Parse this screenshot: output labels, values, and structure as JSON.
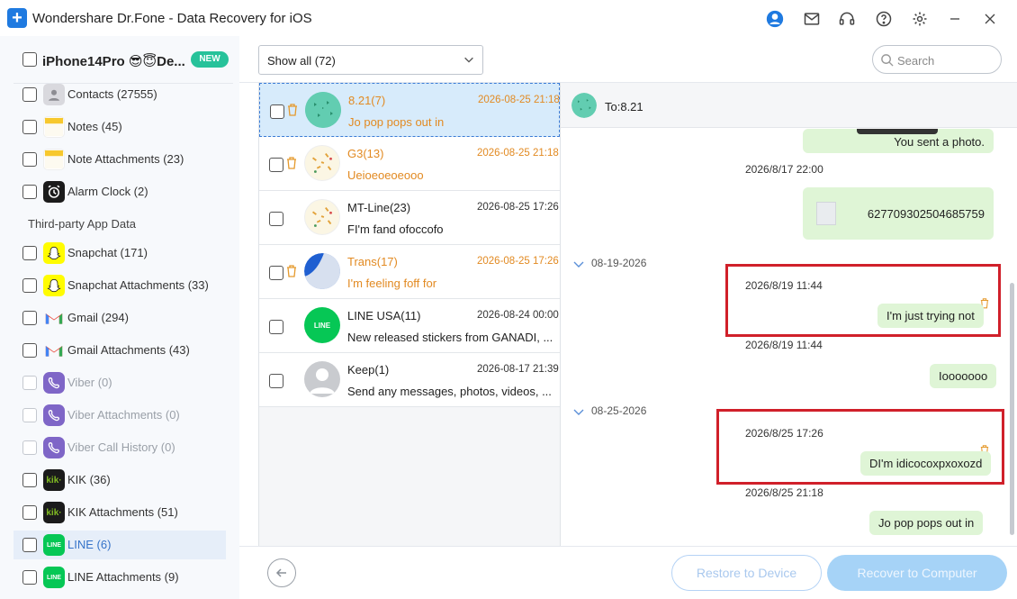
{
  "window": {
    "title": "Wondershare Dr.Fone - Data Recovery for iOS",
    "logo_glyph": "+"
  },
  "sidebar": {
    "device": {
      "name": "iPhone14Pro 😎😇De...",
      "badge": "NEW"
    },
    "section_third_party": "Third-party App Data",
    "items": [
      {
        "label": "Contacts (27555)",
        "icon": "contacts-icon",
        "disabled": false,
        "selected": false
      },
      {
        "label": "Notes (45)",
        "icon": "notes-icon",
        "disabled": false,
        "selected": false
      },
      {
        "label": "Note Attachments (23)",
        "icon": "notes-icon",
        "disabled": false,
        "selected": false
      },
      {
        "label": "Alarm Clock (2)",
        "icon": "alarm-clock-icon",
        "disabled": false,
        "selected": false
      },
      {
        "label": "Snapchat (171)",
        "icon": "snapchat-icon",
        "disabled": false,
        "selected": false
      },
      {
        "label": "Snapchat Attachments (33)",
        "icon": "snapchat-icon",
        "disabled": false,
        "selected": false
      },
      {
        "label": "Gmail (294)",
        "icon": "gmail-icon",
        "disabled": false,
        "selected": false
      },
      {
        "label": "Gmail Attachments (43)",
        "icon": "gmail-icon",
        "disabled": false,
        "selected": false
      },
      {
        "label": "Viber (0)",
        "icon": "viber-icon",
        "disabled": true,
        "selected": false
      },
      {
        "label": "Viber Attachments (0)",
        "icon": "viber-icon",
        "disabled": true,
        "selected": false
      },
      {
        "label": "Viber Call History (0)",
        "icon": "viber-icon",
        "disabled": true,
        "selected": false
      },
      {
        "label": "KIK (36)",
        "icon": "kik-icon",
        "disabled": false,
        "selected": false
      },
      {
        "label": "KIK Attachments (51)",
        "icon": "kik-icon",
        "disabled": false,
        "selected": false
      },
      {
        "label": "LINE (6)",
        "icon": "line-icon",
        "disabled": false,
        "selected": true
      },
      {
        "label": "LINE Attachments (9)",
        "icon": "line-icon",
        "disabled": false,
        "selected": false
      }
    ],
    "icon_text": {
      "kik": "kik·",
      "line": "LINE"
    }
  },
  "toolbar": {
    "filter_value": "Show all (72)",
    "search_placeholder": "Search"
  },
  "conversations": [
    {
      "name": "8.21(7)",
      "time": "2026-08-25 21:18",
      "preview": "Jo pop pops out in",
      "deleted": true,
      "selected": true
    },
    {
      "name": "G3(13)",
      "time": "2026-08-25 21:18",
      "preview": "Ueioeoeoeooo",
      "deleted": true,
      "selected": false
    },
    {
      "name": "MT-Line(23)",
      "time": "2026-08-25 17:26",
      "preview": "FI'm fand ofoccofo",
      "deleted": false,
      "selected": false
    },
    {
      "name": "Trans(17)",
      "time": "2026-08-25 17:26",
      "preview": "I'm feeling foff for",
      "deleted": true,
      "selected": false
    },
    {
      "name": "LINE USA(11)",
      "time": "2026-08-24 00:00",
      "preview": "New released stickers from GANADI, ...",
      "deleted": false,
      "selected": false
    },
    {
      "name": "Keep(1)",
      "time": "2026-08-17 21:39",
      "preview": "Send any messages, photos, videos, ...",
      "deleted": false,
      "selected": false
    }
  ],
  "chat": {
    "header_to": "To:8.21",
    "messages": {
      "photo_bubble": "You sent a photo.",
      "ts1": "2026/8/17 22:00",
      "file_bubble": "627709302504685759",
      "date_sep1": "08-19-2026",
      "ts2": "2026/8/19 11:44",
      "bubble2": "I'm just trying not",
      "ts3": "2026/8/19 11:44",
      "bubble3": "Iooooooo",
      "date_sep2": "08-25-2026",
      "ts4": "2026/8/25 17:26",
      "bubble4": "DI'm idicocoxpxoxozd",
      "ts5": "2026/8/25 21:18",
      "bubble5": "Jo pop pops out in"
    }
  },
  "footer": {
    "restore_label": "Restore to Device",
    "recover_label": "Recover to Computer"
  },
  "colors": {
    "accent": "#1f7ae0",
    "deleted_orange": "#e28a22",
    "bubble_green": "#dff5d6",
    "highlight_red": "#d0202a",
    "new_badge": "#27c29a"
  }
}
